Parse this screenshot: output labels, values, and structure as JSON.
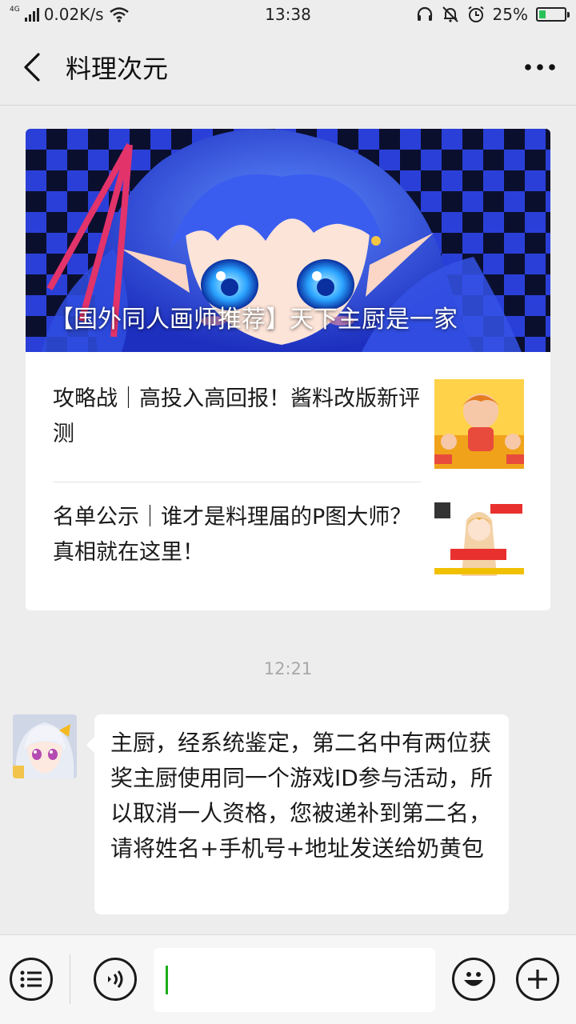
{
  "status_bar": {
    "network_type": "4G",
    "speed": "0.02K/s",
    "time": "13:38",
    "battery_percent": "25%",
    "battery_level": 0.25,
    "icons": [
      "signal-icon",
      "wifi-icon",
      "headset-icon",
      "mute-bell-icon",
      "alarm-icon",
      "battery-icon"
    ]
  },
  "nav": {
    "title": "料理次元",
    "back_icon": "back-arrow-icon",
    "more_icon": "more-dots-icon"
  },
  "article_card": {
    "cover_title": "【国外同人画师推荐】天下主厨是一家",
    "items": [
      {
        "title": "攻略战｜高投入高回报！酱料改版新评测"
      },
      {
        "title": "名单公示｜谁才是料理届的P图大师？真相就在这里！"
      }
    ]
  },
  "chat": {
    "timestamp": "12:21",
    "messages": [
      {
        "sender": "料理次元",
        "text": "主厨，经系统鉴定，第二名中有两位获奖主厨使用同一个游戏ID参与活动，所以取消一人资格，您被递补到第二名，请将姓名+手机号+地址发送给奶黄包"
      }
    ]
  },
  "input_bar": {
    "placeholder": "",
    "icons": [
      "menu-list-icon",
      "voice-icon",
      "emoji-icon",
      "add-icon"
    ]
  },
  "colors": {
    "background": "#ededed",
    "accent_green": "#1aad19",
    "battery_green": "#2bc15a"
  }
}
